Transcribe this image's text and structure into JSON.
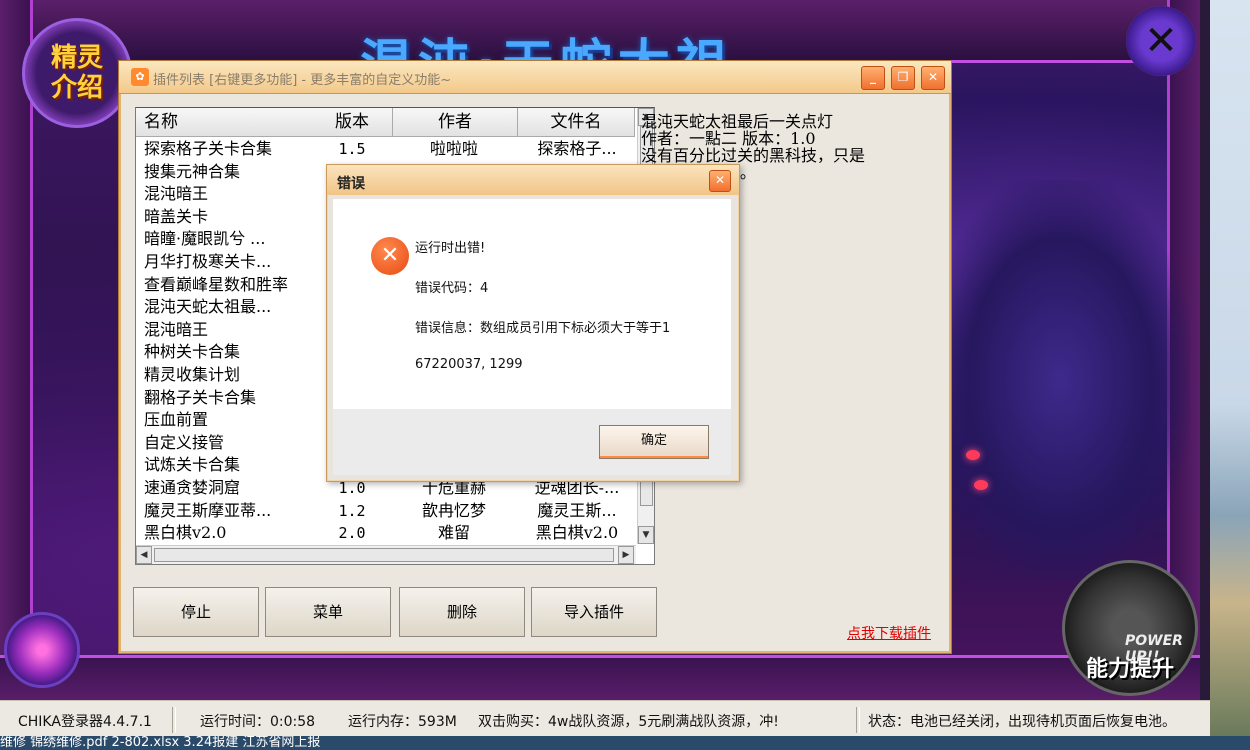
{
  "game": {
    "title_art": "混沌·天蛇太祖",
    "intro_badge": "精灵\n介绍",
    "close_symbol": "✕",
    "power_label": "能力提升",
    "power_sub": "POWER UP!!"
  },
  "plugin_window": {
    "title": "插件列表 [右键更多功能] - 更多丰富的自定义功能~",
    "columns": [
      "名称",
      "版本",
      "作者",
      "文件名"
    ],
    "rows": [
      {
        "name": "探索格子关卡合集",
        "version": "1.5",
        "author": "啦啦啦",
        "file": "探索格子..."
      },
      {
        "name": "搜集元神合集",
        "version": "",
        "author": "",
        "file": ""
      },
      {
        "name": "混沌暗王",
        "version": "",
        "author": "",
        "file": ""
      },
      {
        "name": "暗盖关卡",
        "version": "",
        "author": "",
        "file": ""
      },
      {
        "name": "暗瞳·魔眼凯兮 ...",
        "version": "",
        "author": "",
        "file": ""
      },
      {
        "name": "月华打极寒关卡...",
        "version": "",
        "author": "",
        "file": ""
      },
      {
        "name": "查看巅峰星数和胜率",
        "version": "",
        "author": "",
        "file": ""
      },
      {
        "name": "混沌天蛇太祖最...",
        "version": "",
        "author": "",
        "file": ""
      },
      {
        "name": "混沌暗王",
        "version": "",
        "author": "",
        "file": ""
      },
      {
        "name": "种树关卡合集",
        "version": "",
        "author": "",
        "file": ""
      },
      {
        "name": "精灵收集计划",
        "version": "",
        "author": "",
        "file": ""
      },
      {
        "name": "翻格子关卡合集",
        "version": "",
        "author": "",
        "file": ""
      },
      {
        "name": "压血前置",
        "version": "",
        "author": "",
        "file": ""
      },
      {
        "name": "自定义接管",
        "version": "",
        "author": "",
        "file": ""
      },
      {
        "name": "试炼关卡合集",
        "version": "",
        "author": "",
        "file": ""
      },
      {
        "name": "速通贪婪洞窟",
        "version": "1.0",
        "author": "十危重赫",
        "file": "逆魂团长-..."
      },
      {
        "name": "魔灵王斯摩亚蒂...",
        "version": "1.2",
        "author": "歆冉忆梦",
        "file": "魔灵王斯..."
      },
      {
        "name": "黑白棋v2.0",
        "version": "2.0",
        "author": "难留",
        "file": "黑白棋v2.0"
      }
    ],
    "description_lines": [
      "混沌天蛇太祖最后一关点灯",
      "作者：一點二  版本：1.0",
      "没有百分比过关的黑科技，只是",
      "          万案打。"
    ],
    "buttons": {
      "stop": "停止",
      "menu": "菜单",
      "delete": "删除",
      "import": "导入插件"
    },
    "download_link": "点我下载插件"
  },
  "error_dialog": {
    "title": "错误",
    "line1": "运行时出错!",
    "line2": "错误代码：4",
    "line3": "错误信息：数组成员引用下标必须大于等于1",
    "line4": "67220037, 1299",
    "ok": "确定"
  },
  "status_bar": {
    "app": "CHIKA登录器4.4.7.1",
    "runtime": "运行时间：0:0:58",
    "memory": "运行内存：593M",
    "promo": "双击购买：4w战队资源，5元刷满战队资源，冲!",
    "state": "状态：电池已经关闭，出现待机页面后恢复电池。"
  },
  "taskbar_text": "维修    锦绣维修.pdf   2-802.xlsx      3.24报建     江苏省网上报"
}
